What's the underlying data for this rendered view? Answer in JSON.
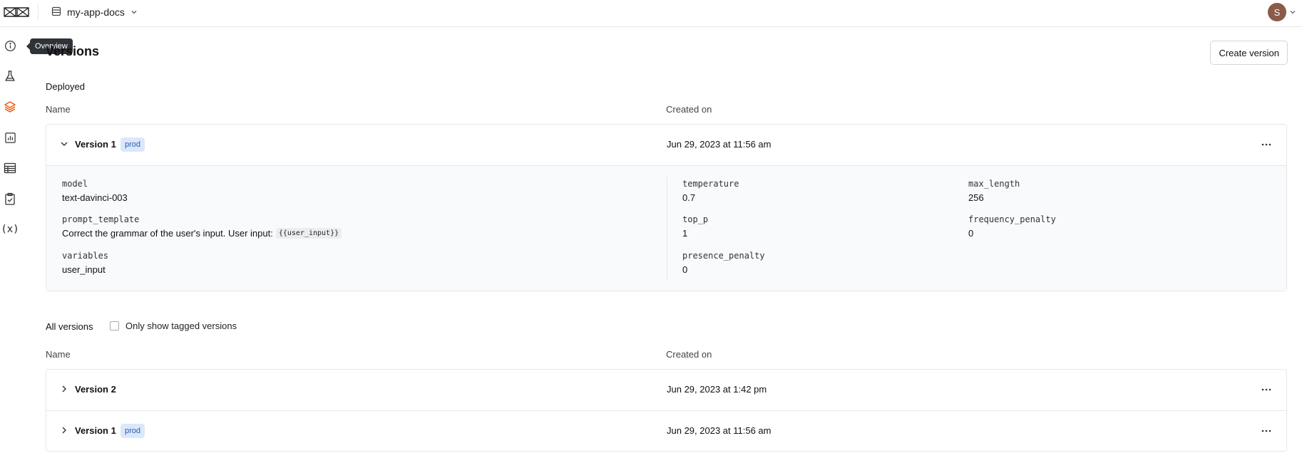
{
  "header": {
    "project_name": "my-app-docs",
    "avatar_initial": "S"
  },
  "sidebar": {
    "tooltip": "Overview",
    "items": [
      {
        "icon": "info-icon"
      },
      {
        "icon": "flask-icon"
      },
      {
        "icon": "layers-icon",
        "active": true
      },
      {
        "icon": "chart-icon"
      },
      {
        "icon": "table-icon"
      },
      {
        "icon": "clipboard-check-icon"
      },
      {
        "icon": "variable-icon"
      }
    ]
  },
  "page": {
    "title": "Versions",
    "create_button": "Create version"
  },
  "deployed": {
    "label": "Deployed",
    "col_name": "Name",
    "col_created": "Created on",
    "version": {
      "name": "Version 1",
      "tag": "prod",
      "created": "Jun 29, 2023 at 11:56 am"
    },
    "details": {
      "model_key": "model",
      "model_val": "text-davinci-003",
      "prompt_key": "prompt_template",
      "prompt_val": "Correct the grammar of the user's input. User input:",
      "prompt_var": "{{user_input}}",
      "variables_key": "variables",
      "variables_val": "user_input",
      "temperature_key": "temperature",
      "temperature_val": "0.7",
      "top_p_key": "top_p",
      "top_p_val": "1",
      "presence_key": "presence_penalty",
      "presence_val": "0",
      "max_length_key": "max_length",
      "max_length_val": "256",
      "frequency_key": "frequency_penalty",
      "frequency_val": "0"
    }
  },
  "all_versions": {
    "label": "All versions",
    "filter_label": "Only show tagged versions",
    "filter_checked": false,
    "col_name": "Name",
    "col_created": "Created on",
    "rows": [
      {
        "name": "Version 2",
        "tag": "",
        "created": "Jun 29, 2023 at 1:42 pm"
      },
      {
        "name": "Version 1",
        "tag": "prod",
        "created": "Jun 29, 2023 at 11:56 am"
      }
    ]
  },
  "colors": {
    "accent": "#e8590c",
    "badge_bg": "#dbe8fb",
    "badge_text": "#2a5db0",
    "avatar": "#8b5a4a"
  }
}
